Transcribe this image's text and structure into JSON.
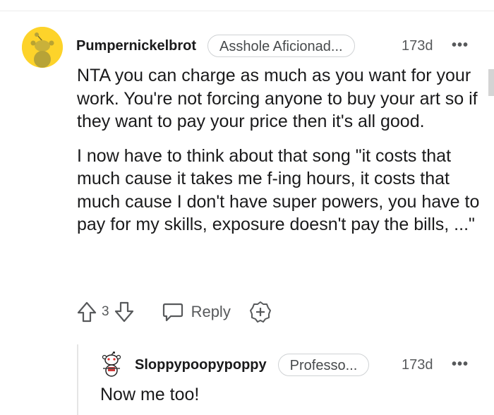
{
  "comment": {
    "username": "Pumpernickelbrot",
    "flair": "Asshole Aficionad...",
    "age": "173d",
    "more_label": "•••",
    "paragraphs": [
      "NTA you can charge as much as you want for your work. You're not forcing anyone to buy your art so if they want to pay your price then it's all good.",
      "I now have to think about that song \"it costs that much cause it takes me f-ing hours, it costs that much cause I don't have super powers, you have to pay for my skills, exposure doesn't pay the bills, ...\""
    ],
    "score": "3",
    "reply_label": "Reply",
    "avatar_color": "#fdd32a"
  },
  "reply": {
    "username": "Sloppypoopypoppy",
    "flair": "Professo...",
    "age": "173d",
    "more_label": "•••",
    "text": "Now me too!"
  },
  "icons": [
    "upvote-icon",
    "downvote-icon",
    "reply-icon",
    "award-icon",
    "more-icon"
  ]
}
